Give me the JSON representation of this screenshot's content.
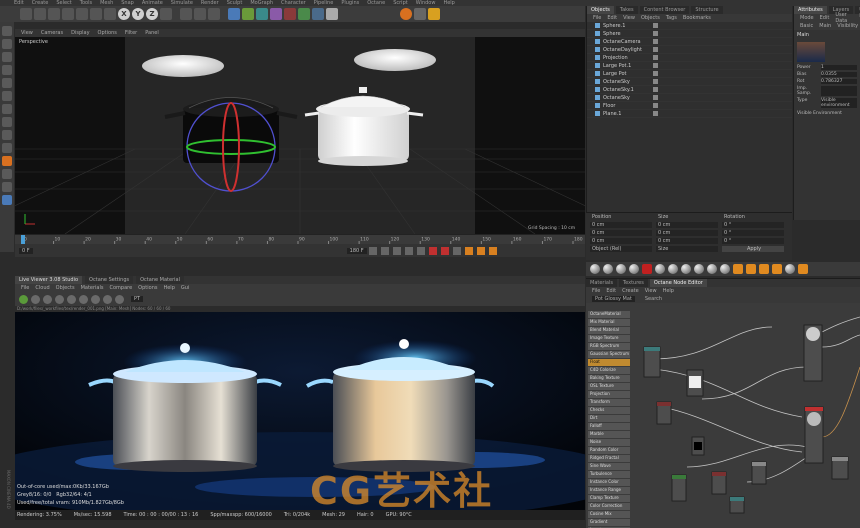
{
  "menubar": {
    "items": [
      "Edit",
      "Create",
      "Select",
      "Tools",
      "Mesh",
      "Snap",
      "Animate",
      "Simulate",
      "Render",
      "Sculpt",
      "MoGraph",
      "Character",
      "Pipeline",
      "Plugins",
      "Octane",
      "Script",
      "Window",
      "Help"
    ]
  },
  "toolbar": {
    "axis_x": "X",
    "axis_y": "Y",
    "axis_z": "Z"
  },
  "viewport": {
    "menu": [
      "View",
      "Cameras",
      "Display",
      "Options",
      "Filter",
      "Panel"
    ],
    "label": "Perspective",
    "grid_spacing": "Grid Spacing : 10 cm"
  },
  "timeline": {
    "ticks": [
      "0",
      "10",
      "20",
      "30",
      "40",
      "50",
      "60",
      "70",
      "80",
      "90",
      "100",
      "110",
      "120",
      "130",
      "140",
      "150",
      "160",
      "170",
      "180"
    ],
    "start_frame": "0 F",
    "end_frame": "180 F",
    "current_frame": "0 F"
  },
  "render_window": {
    "tabs": [
      "Live Viewer 3.08 Studio",
      "Octane Settings",
      "Octane Material"
    ],
    "active_tab": "Live Viewer 3.08 Studio",
    "menu": [
      "File",
      "Cloud",
      "Objects",
      "Materials",
      "Compare",
      "Options",
      "Help",
      "Gui"
    ],
    "preset": "PT",
    "path": "D:/work/files/_workfiles/tex/render_001.png   [Main: Mesh] Nodes: 60 / 60 / 60",
    "stats": {
      "out_of_core": "Out-of-core used/max:0Kb/33.167Gb",
      "grey": "Grey8/16: 0/0",
      "rgb": "Rgb32/64: 4/1",
      "vram": "Used/free/total vram: 910Mb/1.827Gb/8Gb"
    },
    "status": {
      "rendering": "Rendering: 3.75%",
      "ms_sec": "Ms/sec: 15.598",
      "time": "Time: 00 : 00 : 00/00 : 13 : 16",
      "spp": "Spp/maxspp: 600/16000",
      "tri": "Tri: 0/204k",
      "mesh": "Mesh: 29",
      "hair": "Hair: 0",
      "gpu": "GPU: 90°C"
    }
  },
  "watermark": "CG艺术社",
  "side_label": "MAXON CINEMA 4D",
  "object_manager": {
    "tabs": [
      "Objects",
      "Takes",
      "Content Browser",
      "Structure"
    ],
    "active_tab": "Objects",
    "menu": [
      "File",
      "Edit",
      "View",
      "Objects",
      "Tags",
      "Bookmarks"
    ],
    "items": [
      {
        "name": "Sphere.1"
      },
      {
        "name": "Sphere"
      },
      {
        "name": "OctaneCamera"
      },
      {
        "name": "OctaneDaylight"
      },
      {
        "name": "Projection"
      },
      {
        "name": "Large Pot.1"
      },
      {
        "name": "Large Pot"
      },
      {
        "name": "OctaneSky"
      },
      {
        "name": "OctaneSky.1"
      },
      {
        "name": "OctaneSky"
      },
      {
        "name": "Floor"
      },
      {
        "name": "Plane.1"
      }
    ]
  },
  "attributes": {
    "tabs": [
      "Attributes",
      "Layers",
      "User Data"
    ],
    "menu": [
      "Mode",
      "Edit",
      "User Data"
    ],
    "subtabs": [
      "Basic",
      "Main",
      "Visibility"
    ],
    "section": "Main",
    "fields": [
      {
        "label": "Power",
        "value": "1"
      },
      {
        "label": "Bias",
        "value": "0.0355"
      },
      {
        "label": "Rot",
        "value": "0.786327"
      },
      {
        "label": "Imp. Samp.",
        "value": ""
      },
      {
        "label": "Type",
        "value": "Visible environment"
      }
    ],
    "visible_env": "Visible Environment"
  },
  "coordinates": {
    "headers": [
      "Position",
      "Size",
      "Rotation"
    ],
    "rows": [
      {
        "pos": "0 cm",
        "size": "0 cm",
        "rot": "0 °"
      },
      {
        "pos": "0 cm",
        "size": "0 cm",
        "rot": "0 °"
      },
      {
        "pos": "0 cm",
        "size": "0 cm",
        "rot": "0 °"
      }
    ],
    "mode": "Object (Rel)",
    "size_mode": "Size",
    "apply": "Apply"
  },
  "node_editor": {
    "tabs": [
      "Materials",
      "Textures",
      "Octane Node Editor"
    ],
    "active_tab": "Octane Node Editor",
    "menu": [
      "File",
      "Edit",
      "Create",
      "View",
      "Help"
    ],
    "material": "Pot Glossy Mat",
    "search": "Search",
    "node_list": [
      "OctaneMaterial",
      "Mix Material",
      "Blend Material",
      "Image Texture",
      "RGB Spectrum",
      "Gaussian Spectrum",
      "Float",
      "C4D Colorize",
      "Baking Texture",
      "OSL Texture",
      "Projection",
      "Transform",
      "Checks",
      "Dirt",
      "Falloff",
      "Marble",
      "Noise",
      "Random Color",
      "Ridged Fractal",
      "Sine Wave",
      "Turbulence",
      "Instance Color",
      "Instance Range",
      "Clamp Texture",
      "Color Correction",
      "Cosine Mix",
      "Gradient",
      "Invert",
      "Mix"
    ],
    "highlighted": "Float"
  }
}
